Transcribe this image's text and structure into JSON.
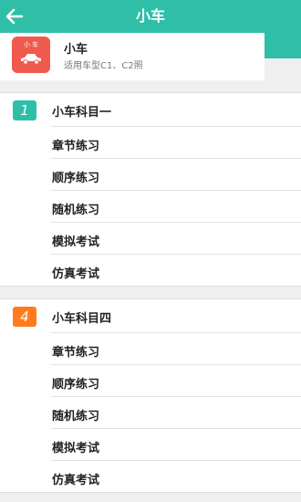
{
  "header": {
    "title": "小车",
    "back_icon": "arrow-left-icon",
    "bg_color": "#2fbfa8"
  },
  "vehicle": {
    "icon_label": "小 车",
    "name": "小车",
    "subtitle": "适用车型C1、C2照",
    "icon": "car-icon",
    "icon_color": "#f05a4e"
  },
  "sections": [
    {
      "number": "1",
      "title": "小车科目一",
      "color": "#2fbfa8",
      "items": [
        "章节练习",
        "顺序练习",
        "随机练习",
        "模拟考试",
        "仿真考试"
      ]
    },
    {
      "number": "4",
      "title": "小车科目四",
      "color": "#ff7a1a",
      "items": [
        "章节练习",
        "顺序练习",
        "随机练习",
        "模拟考试",
        "仿真考试"
      ]
    }
  ]
}
